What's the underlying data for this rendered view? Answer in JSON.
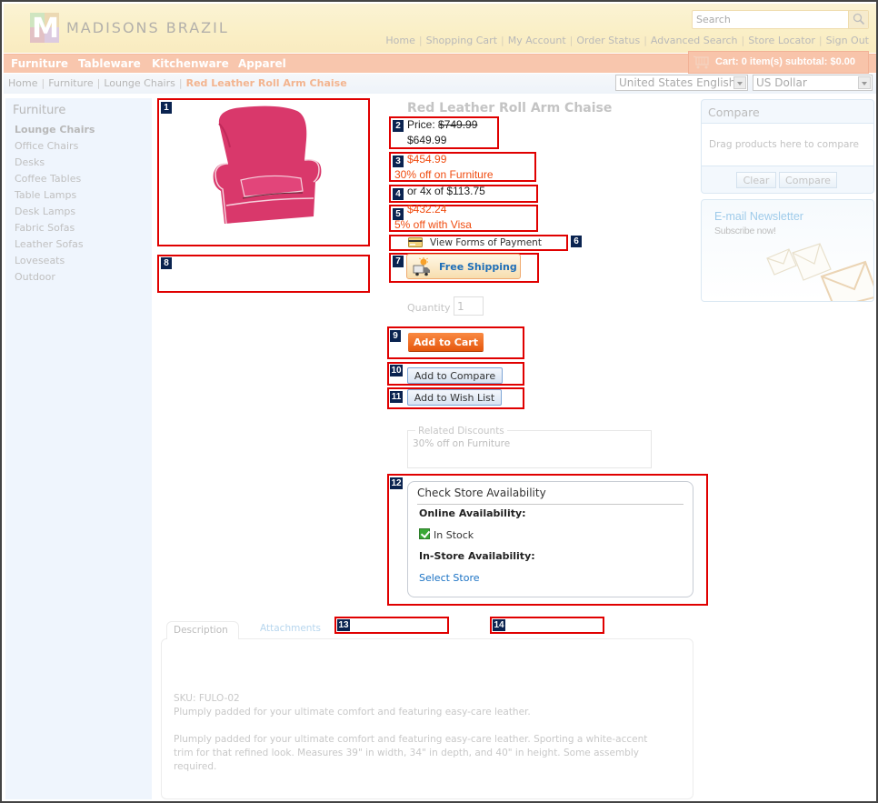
{
  "header": {
    "brand": "MADISONS BRAZIL",
    "search_placeholder": "Search",
    "top_links": [
      "Home",
      "Shopping Cart",
      "My Account",
      "Order Status",
      "Advanced Search",
      "Store Locator",
      "Sign Out"
    ]
  },
  "nav": {
    "categories": [
      "Furniture",
      "Tableware",
      "Kitchenware",
      "Apparel"
    ],
    "cart_summary": "Cart: 0 item(s) subtotal: $0.00"
  },
  "breadcrumb": {
    "items": [
      "Home",
      "Furniture",
      "Lounge Chairs"
    ],
    "current": "Red Leather Roll Arm Chaise"
  },
  "locale": {
    "language": "United States English",
    "currency": "US Dollar"
  },
  "sidebar": {
    "title": "Furniture",
    "items": [
      {
        "label": "Lounge Chairs",
        "active": true
      },
      {
        "label": "Office Chairs"
      },
      {
        "label": "Desks"
      },
      {
        "label": "Coffee Tables"
      },
      {
        "label": "Table Lamps"
      },
      {
        "label": "Desk Lamps"
      },
      {
        "label": "Fabric Sofas"
      },
      {
        "label": "Leather Sofas"
      },
      {
        "label": "Loveseats"
      },
      {
        "label": "Outdoor"
      }
    ]
  },
  "product": {
    "title": "Red Leather Roll Arm Chaise",
    "price_label": "Price:",
    "list_price": "$749.99",
    "offer_price": "$649.99",
    "promo_price": "$454.99",
    "promo_text": "30% off on Furniture",
    "installments": "or 4x of $113.75",
    "visa_price": "$432.24",
    "visa_text": "5% off with Visa",
    "payment_link": "View Forms of Payment",
    "free_shipping": "Free Shipping",
    "quantity_label": "Quantity",
    "quantity_value": "1",
    "add_to_cart": "Add to Cart",
    "add_to_compare": "Add to Compare",
    "add_to_wishlist": "Add to Wish List",
    "related_discounts": {
      "legend": "Related Discounts",
      "text": "30% off on Furniture"
    }
  },
  "availability": {
    "title": "Check Store Availability",
    "online_label": "Online Availability:",
    "online_status": "In Stock",
    "instore_label": "In-Store Availability:",
    "select_store": "Select Store"
  },
  "compare": {
    "title": "Compare",
    "hint": "Drag products here to compare",
    "clear": "Clear",
    "compare": "Compare"
  },
  "newsletter": {
    "title": "E-mail Newsletter",
    "subtitle": "Subscribe now!"
  },
  "tabs": {
    "items": [
      "Description",
      "Attachments"
    ],
    "sku": "SKU: FULO-02",
    "short_description": "Plumply padded for your ultimate comfort and featuring easy-care leather.",
    "long_description": [
      "Plumply padded for your ultimate comfort and featuring easy-care leather. Sporting a white-accent",
      "trim for that refined look. Measures 39\" in width, 34\" in depth, and 40\" in height. Some assembly",
      "required."
    ]
  },
  "annotations": [
    "1",
    "2",
    "3",
    "4",
    "5",
    "6",
    "7",
    "8",
    "9",
    "10",
    "11",
    "12",
    "13",
    "14"
  ],
  "colors": {
    "accent_orange": "#f04c10",
    "nav_bar": "#f8c6ad",
    "annotation_red": "#e00000",
    "badge_navy": "#0a2350",
    "link_blue": "#1a72c4"
  }
}
